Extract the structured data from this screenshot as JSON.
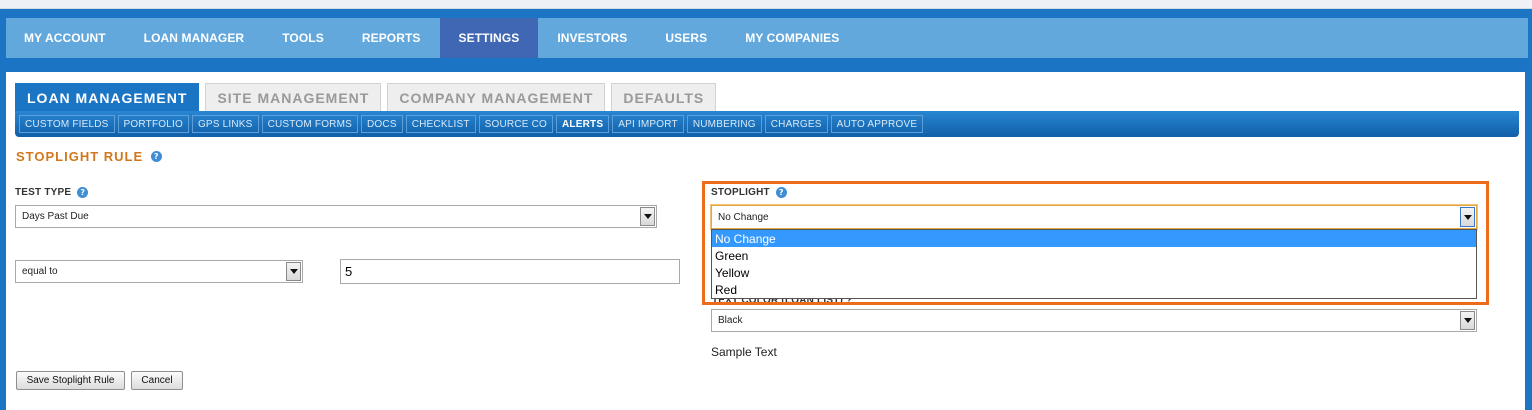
{
  "main_nav": [
    {
      "label": "MY ACCOUNT",
      "active": false
    },
    {
      "label": "LOAN MANAGER",
      "active": false
    },
    {
      "label": "TOOLS",
      "active": false
    },
    {
      "label": "REPORTS",
      "active": false
    },
    {
      "label": "SETTINGS",
      "active": true
    },
    {
      "label": "INVESTORS",
      "active": false
    },
    {
      "label": "USERS",
      "active": false
    },
    {
      "label": "MY COMPANIES",
      "active": false
    }
  ],
  "tabs": [
    {
      "label": "LOAN MANAGEMENT",
      "active": true
    },
    {
      "label": "SITE MANAGEMENT",
      "active": false
    },
    {
      "label": "COMPANY MANAGEMENT",
      "active": false
    },
    {
      "label": "DEFAULTS",
      "active": false
    }
  ],
  "sub_nav": [
    {
      "label": "CUSTOM FIELDS",
      "active": false
    },
    {
      "label": "PORTFOLIO",
      "active": false
    },
    {
      "label": "GPS LINKS",
      "active": false
    },
    {
      "label": "CUSTOM FORMS",
      "active": false
    },
    {
      "label": "DOCS",
      "active": false
    },
    {
      "label": "CHECKLIST",
      "active": false
    },
    {
      "label": "SOURCE CO",
      "active": false
    },
    {
      "label": "ALERTS",
      "active": true
    },
    {
      "label": "API IMPORT",
      "active": false
    },
    {
      "label": "NUMBERING",
      "active": false
    },
    {
      "label": "CHARGES",
      "active": false
    },
    {
      "label": "AUTO APPROVE",
      "active": false
    }
  ],
  "section_title": "STOPLIGHT RULE",
  "help_glyph": "?",
  "test_type": {
    "label": "TEST TYPE",
    "value": "Days Past Due",
    "operator": "equal to",
    "amount": "5"
  },
  "stoplight": {
    "label": "STOPLIGHT",
    "value": "No Change",
    "options": [
      "No Change",
      "Green",
      "Yellow",
      "Red"
    ],
    "selected_index": 0
  },
  "text_color": {
    "label_partial": "TEXT COLOR (LOAN LIST) ?",
    "value": "Black"
  },
  "sample_text": "Sample Text",
  "buttons": {
    "save": "Save Stoplight Rule",
    "cancel": "Cancel"
  },
  "colors": {
    "nav_bg": "#63a8dc",
    "nav_active": "#3f67b4",
    "section_title": "#d2781c",
    "highlight_border": "#ec6c1c",
    "option_selected": "#3399ff"
  }
}
